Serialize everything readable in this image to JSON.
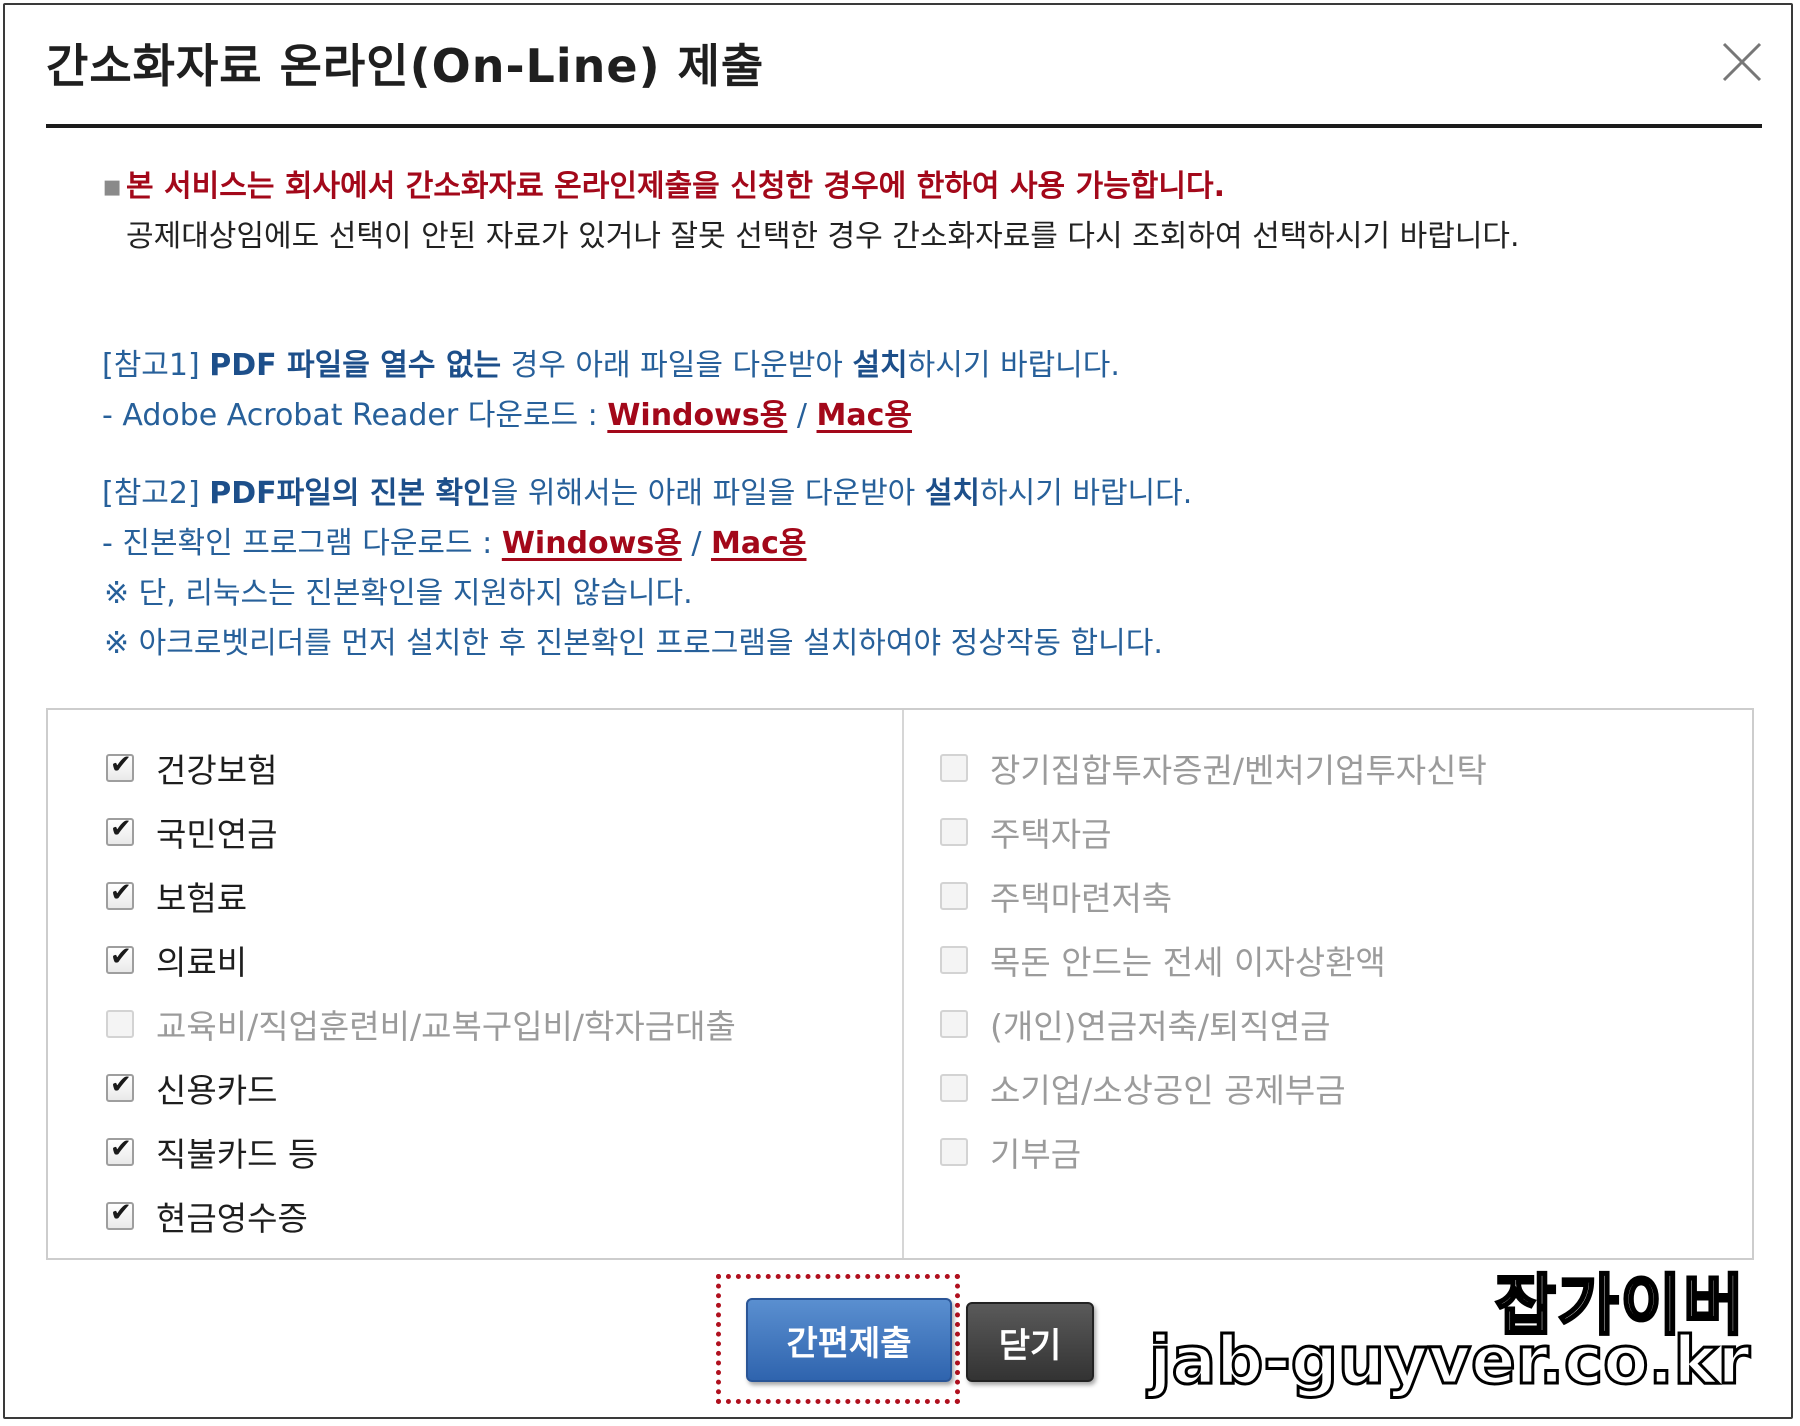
{
  "dialog": {
    "title": "간소화자료 온라인(On-Line) 제출",
    "close_icon": "close-icon"
  },
  "notice": {
    "bullet": "▪",
    "highlight": "본 서비스는 회사에서 간소화자료 온라인제출을 신청한 경우에 한하여 사용 가능합니다.",
    "body": "공제대상임에도 선택이 안된 자료가 있거나 잘못 선택한 경우 간소화자료를 다시 조회하여 선택하시기 바랍니다."
  },
  "ref1": {
    "prefix": "[참고1] ",
    "bold1": "PDF 파일을 열수 없는",
    "mid": " 경우  아래 파일을 다운받아 ",
    "bold2": "설치",
    "suffix": "하시기 바랍니다.",
    "download_prefix": "- Adobe Acrobat Reader 다운로드 : ",
    "windows": "Windows용",
    "sep": " / ",
    "mac": "Mac용"
  },
  "ref2": {
    "prefix": "[참고2] ",
    "bold1": "PDF파일의 진본 확인",
    "mid": "을 위해서는 아래 파일을 다운받아 ",
    "bold2": "설치",
    "suffix": "하시기 바랍니다.",
    "download_prefix": "- 진본확인 프로그램 다운로드 : ",
    "windows": "Windows용",
    "sep": " / ",
    "mac": "Mac용",
    "note1": "※ 단, 리눅스는 진본확인을 지원하지 않습니다.",
    "note2": "※ 아크로벳리더를 먼저 설치한 후 진본확인 프로그램을 설치하여야 정상작동 합니다."
  },
  "left_items": [
    {
      "label": "건강보험",
      "checked": true,
      "enabled": true
    },
    {
      "label": "국민연금",
      "checked": true,
      "enabled": true
    },
    {
      "label": "보험료",
      "checked": true,
      "enabled": true
    },
    {
      "label": "의료비",
      "checked": true,
      "enabled": true
    },
    {
      "label": "교육비/직업훈련비/교복구입비/학자금대출",
      "checked": false,
      "enabled": false
    },
    {
      "label": "신용카드",
      "checked": true,
      "enabled": true
    },
    {
      "label": "직불카드 등",
      "checked": true,
      "enabled": true
    },
    {
      "label": "현금영수증",
      "checked": true,
      "enabled": true
    }
  ],
  "right_items": [
    {
      "label": "장기집합투자증권/벤처기업투자신탁",
      "checked": false,
      "enabled": false
    },
    {
      "label": "주택자금",
      "checked": false,
      "enabled": false
    },
    {
      "label": "주택마련저축",
      "checked": false,
      "enabled": false
    },
    {
      "label": "목돈 안드는 전세 이자상환액",
      "checked": false,
      "enabled": false
    },
    {
      "label": "(개인)연금저축/퇴직연금",
      "checked": false,
      "enabled": false
    },
    {
      "label": "소기업/소상공인 공제부금",
      "checked": false,
      "enabled": false
    },
    {
      "label": "기부금",
      "checked": false,
      "enabled": false
    }
  ],
  "buttons": {
    "submit": "간편제출",
    "close": "닫기"
  },
  "watermark": {
    "line1": "잡가이버",
    "line2": "jab-guyver.co.kr"
  },
  "colors": {
    "highlight_red": "#a3081a",
    "link_blue": "#27609a",
    "submit_blue": "#3a70b8",
    "close_dark": "#3f3f3f"
  }
}
